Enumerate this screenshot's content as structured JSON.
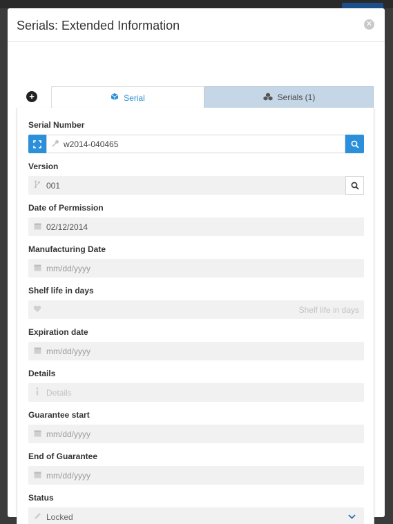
{
  "modal": {
    "title": "Serials: Extended Information",
    "close_glyph": "✕"
  },
  "tabs": [
    {
      "label": "Serial",
      "icon": "cube-icon",
      "active": true
    },
    {
      "label": "Serials (1)",
      "icon": "cubes-icon",
      "active": false
    }
  ],
  "form": {
    "serial_number": {
      "label": "Serial Number",
      "value": "w2014-040465"
    },
    "version": {
      "label": "Version",
      "value": "001"
    },
    "date_of_permission": {
      "label": "Date of Permission",
      "value": "02/12/2014"
    },
    "manufacturing_date": {
      "label": "Manufacturing Date",
      "placeholder": "mm/dd/yyyy"
    },
    "shelf_life": {
      "label": "Shelf life in days",
      "placeholder": "Shelf life in days"
    },
    "expiration_date": {
      "label": "Expiration date",
      "placeholder": "mm/dd/yyyy"
    },
    "details": {
      "label": "Details",
      "placeholder": "Details"
    },
    "guarantee_start": {
      "label": "Guarantee start",
      "placeholder": "mm/dd/yyyy"
    },
    "end_of_guarantee": {
      "label": "End of Guarantee",
      "placeholder": "mm/dd/yyyy"
    },
    "status": {
      "label": "Status",
      "value": "Locked"
    }
  },
  "colors": {
    "accent": "#2b90d9",
    "tab_inactive_bg": "#c5d6e6",
    "input_bg": "#f1f1f1"
  }
}
